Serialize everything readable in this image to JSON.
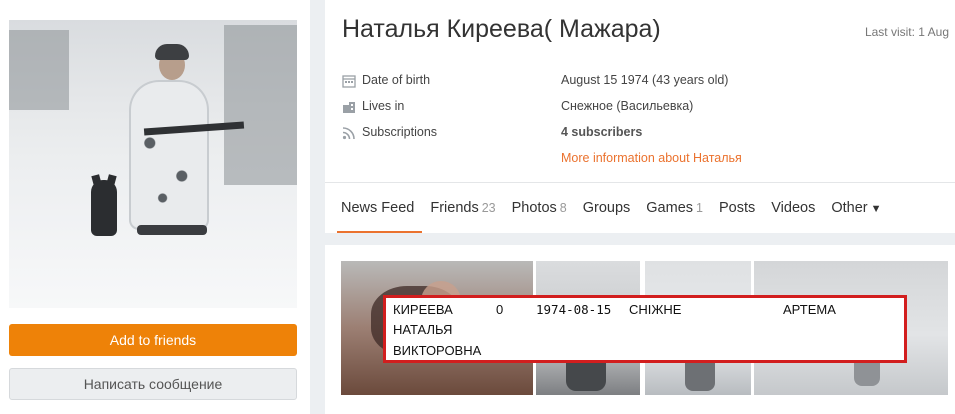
{
  "profile": {
    "name": "Наталья Киреева( Мажара)",
    "last_visit": "Last visit: 1 Aug",
    "info": [
      {
        "icon": "calendar-icon",
        "label": "Date of birth",
        "value": "August 15 1974 (43 years old)"
      },
      {
        "icon": "house-icon",
        "label": "Lives in",
        "value": "Снежное (Васильевка)"
      },
      {
        "icon": "rss-icon",
        "label": "Subscriptions",
        "value": "4 subscribers"
      }
    ],
    "more_link": "More information about Наталья"
  },
  "actions": {
    "add_friends": "Add to friends",
    "send_message": "Написать сообщение"
  },
  "tabs": [
    {
      "label": "News Feed",
      "count": ""
    },
    {
      "label": "Friends",
      "count": "23"
    },
    {
      "label": "Photos",
      "count": "8"
    },
    {
      "label": "Groups",
      "count": ""
    },
    {
      "label": "Games",
      "count": "1"
    },
    {
      "label": "Posts",
      "count": ""
    },
    {
      "label": "Videos",
      "count": ""
    },
    {
      "label": "Other",
      "count": "",
      "caret": "▼"
    }
  ],
  "overlay_record": {
    "surname": "КИРЕЕВА",
    "first_name": "НАТАЛЬЯ",
    "patronymic": "ВИКТОРОВНА",
    "code": "0",
    "date": "1974-08-15",
    "place": "СНІЖНЕ",
    "street": "АРТЕМА"
  },
  "colors": {
    "accent": "#ee8208",
    "link": "#eb722e",
    "highlight_box": "#d21e1e"
  }
}
